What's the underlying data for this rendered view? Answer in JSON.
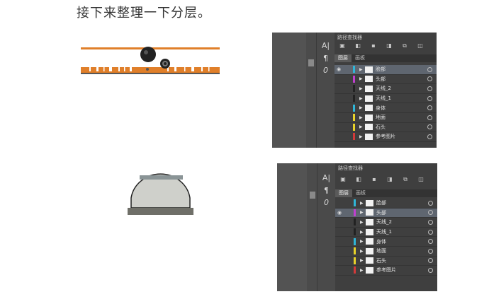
{
  "heading": "接下来整理一下分层。",
  "colors": {
    "orange": "#e07f2a",
    "dark": "#222222",
    "dome_fill": "#cfd0cb",
    "dome_band": "#8a9496",
    "base": "#6f6f68",
    "panel_bg": "#3f3f3f"
  },
  "panel_top": {
    "title": "路径查找器",
    "toolbar_icons": [
      "path-unite-icon",
      "path-minus-icon",
      "path-intersect-icon",
      "path-exclude-icon",
      "path-divide-icon",
      "path-trim-icon"
    ],
    "tabs": [
      "图层",
      "画板"
    ],
    "tool_glyphs": [
      "A|",
      "¶",
      "0"
    ],
    "layers": [
      {
        "name": "脸部",
        "color": "#2fb6d8",
        "selected": true,
        "visible": true
      },
      {
        "name": "头部",
        "color": "#c03fd0",
        "selected": false,
        "visible": false
      },
      {
        "name": "天线_2",
        "color": "#222222",
        "selected": false,
        "visible": false
      },
      {
        "name": "天线_1",
        "color": "#222222",
        "selected": false,
        "visible": false
      },
      {
        "name": "身体",
        "color": "#2fb6d8",
        "selected": false,
        "visible": false
      },
      {
        "name": "地面",
        "color": "#e8d22a",
        "selected": false,
        "visible": false
      },
      {
        "name": "石头",
        "color": "#e8d22a",
        "selected": false,
        "visible": false
      },
      {
        "name": "参考图片",
        "color": "#d33a3a",
        "selected": false,
        "visible": false
      }
    ]
  },
  "panel_bottom": {
    "title": "路径查找器",
    "toolbar_icons": [
      "path-unite-icon",
      "path-minus-icon",
      "path-intersect-icon",
      "path-exclude-icon",
      "path-divide-icon",
      "path-trim-icon"
    ],
    "tabs": [
      "图层",
      "画板"
    ],
    "tool_glyphs": [
      "A|",
      "¶",
      "0"
    ],
    "layers": [
      {
        "name": "脸部",
        "color": "#2fb6d8",
        "selected": false,
        "visible": false
      },
      {
        "name": "头部",
        "color": "#c03fd0",
        "selected": true,
        "visible": true
      },
      {
        "name": "天线_2",
        "color": "#222222",
        "selected": false,
        "visible": false
      },
      {
        "name": "天线_1",
        "color": "#222222",
        "selected": false,
        "visible": false
      },
      {
        "name": "身体",
        "color": "#2fb6d8",
        "selected": false,
        "visible": false
      },
      {
        "name": "地面",
        "color": "#e8d22a",
        "selected": false,
        "visible": false
      },
      {
        "name": "石头",
        "color": "#e8d22a",
        "selected": false,
        "visible": false
      },
      {
        "name": "参考图片",
        "color": "#d33a3a",
        "selected": false,
        "visible": false
      }
    ]
  }
}
